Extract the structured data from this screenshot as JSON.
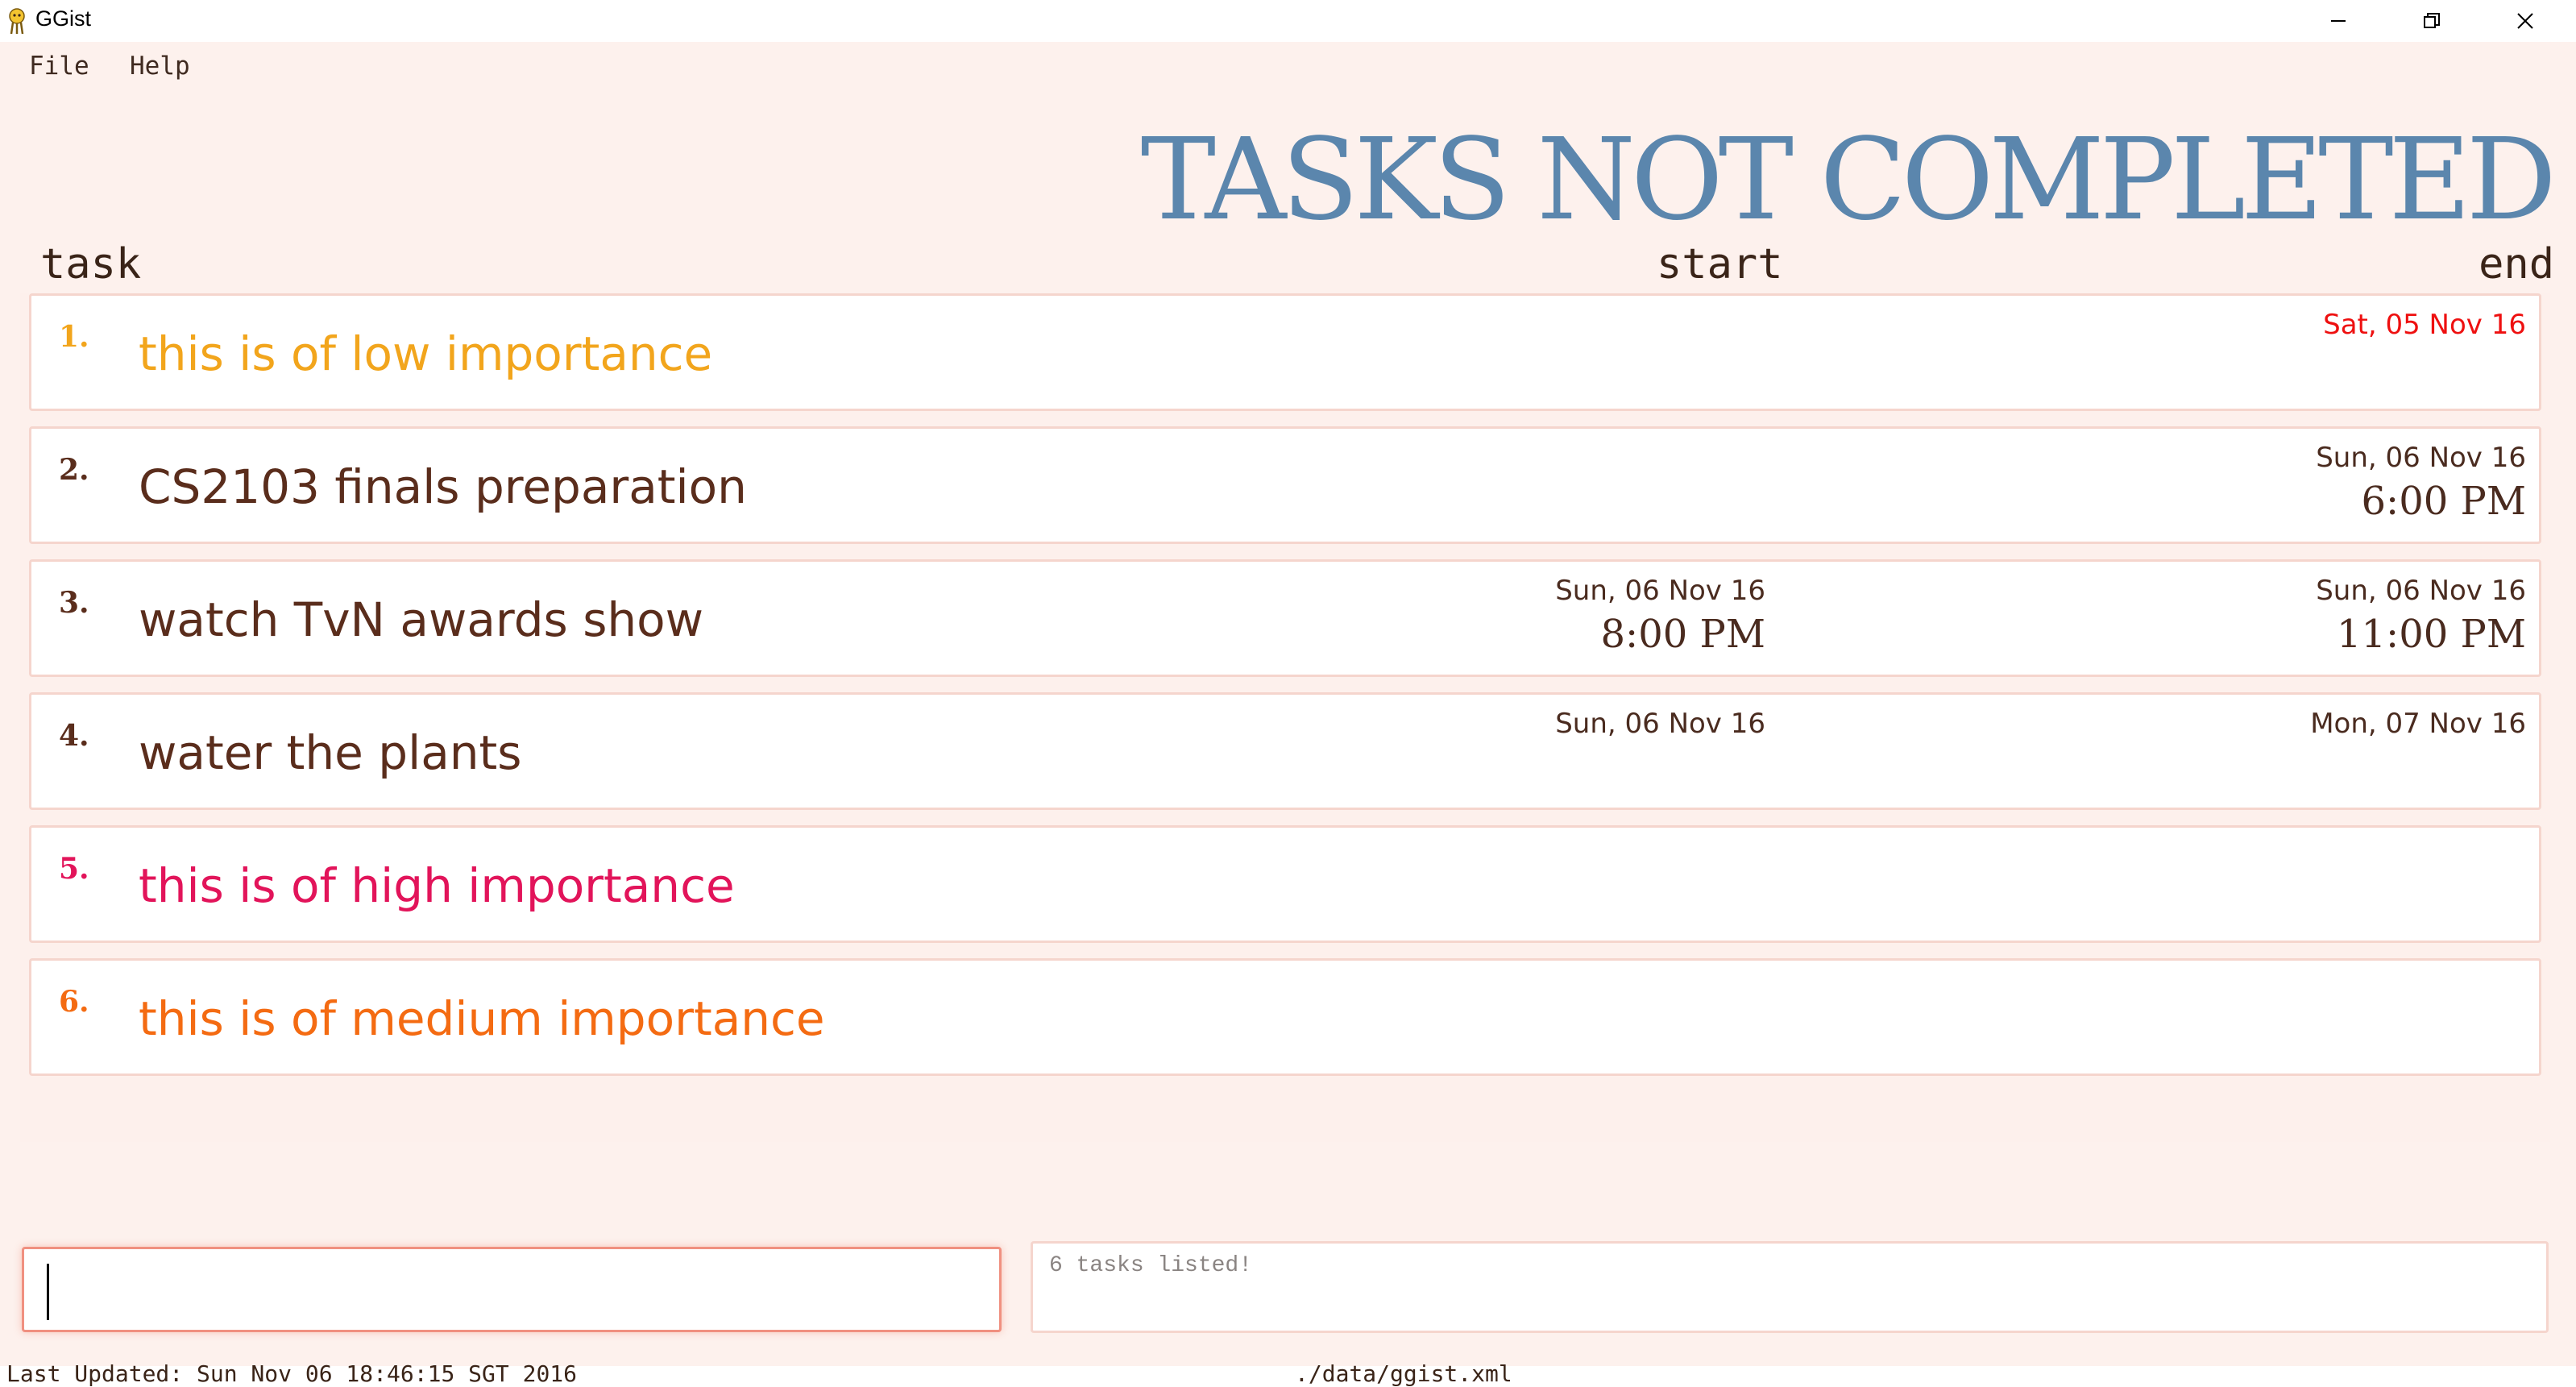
{
  "window": {
    "title": "GGist",
    "controls": {
      "minimize": "minimize",
      "maximize": "restore",
      "close": "close"
    }
  },
  "menu": {
    "file": "File",
    "help": "Help"
  },
  "heading": "TASKS NOT COMPLETED",
  "columns": {
    "task": "task",
    "start": "start",
    "end": "end"
  },
  "tasks": [
    {
      "index": "1.",
      "name": "this is of low importance",
      "name_color": "#f2a51c",
      "start_date": "",
      "start_time": "",
      "end_date": "Sat, 05 Nov 16",
      "end_time": "",
      "end_overdue": true
    },
    {
      "index": "2.",
      "name": "CS2103 finals preparation",
      "name_color": "#5a2d1c",
      "start_date": "",
      "start_time": "",
      "end_date": "Sun, 06 Nov 16",
      "end_time": "6:00 PM",
      "end_overdue": false
    },
    {
      "index": "3.",
      "name": "watch TvN awards show",
      "name_color": "#5a2d1c",
      "start_date": "Sun, 06 Nov 16",
      "start_time": "8:00 PM",
      "end_date": "Sun, 06 Nov 16",
      "end_time": "11:00 PM",
      "end_overdue": false
    },
    {
      "index": "4.",
      "name": "water the plants",
      "name_color": "#5a2d1c",
      "start_date": "Sun, 06 Nov 16",
      "start_time": "",
      "end_date": "Mon, 07 Nov 16",
      "end_time": "",
      "end_overdue": false
    },
    {
      "index": "5.",
      "name": "this is of high importance",
      "name_color": "#e2145a",
      "start_date": "",
      "start_time": "",
      "end_date": "",
      "end_time": "",
      "end_overdue": false
    },
    {
      "index": "6.",
      "name": "this is of medium importance",
      "name_color": "#f46b12",
      "start_date": "",
      "start_time": "",
      "end_date": "",
      "end_time": "",
      "end_overdue": false
    }
  ],
  "command": {
    "value": "",
    "placeholder": ""
  },
  "result": "6 tasks listed!",
  "status": {
    "last_updated": "Last Updated: Sun Nov 06 18:46:15 SGT 2016",
    "file_path": "./data/ggist.xml"
  },
  "colors": {
    "heading": "#5b86ad",
    "background": "#fdf1ed",
    "overdue": "#ee1010",
    "card_border": "#f5d5cd",
    "command_border": "#f09080"
  }
}
